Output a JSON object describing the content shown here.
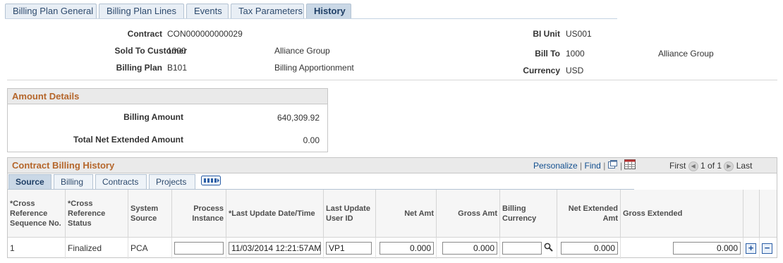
{
  "tabs": [
    {
      "label": "Billing Plan General"
    },
    {
      "label": "Billing Plan Lines"
    },
    {
      "label": "Events"
    },
    {
      "label": "Tax Parameters"
    },
    {
      "label": "History"
    }
  ],
  "header": {
    "contract_label": "Contract",
    "contract_value": "CON000000000029",
    "sold_to_label": "Sold To Customer",
    "sold_to_value": "1000",
    "sold_to_name": "Alliance Group",
    "billing_plan_label": "Billing Plan",
    "billing_plan_value": "B101",
    "billing_plan_desc": "Billing Apportionment",
    "bi_unit_label": "BI Unit",
    "bi_unit_value": "US001",
    "bill_to_label": "Bill To",
    "bill_to_value": "1000",
    "bill_to_name": "Alliance Group",
    "currency_label": "Currency",
    "currency_value": "USD"
  },
  "amount_details": {
    "title": "Amount Details",
    "billing_amount_label": "Billing Amount",
    "billing_amount_value": "640,309.92",
    "total_net_label": "Total Net Extended Amount",
    "total_net_value": "0.00"
  },
  "history": {
    "title": "Contract Billing History",
    "personalize": "Personalize",
    "find": "Find",
    "first": "First",
    "page_info": "1 of 1",
    "last": "Last",
    "subtabs": [
      {
        "label": "Source"
      },
      {
        "label": "Billing"
      },
      {
        "label": "Contracts"
      },
      {
        "label": "Projects"
      }
    ],
    "columns": [
      "*Cross Reference Sequence No.",
      "*Cross Reference Status",
      "System Source",
      "Process Instance",
      "*Last Update Date/Time",
      "Last Update User ID",
      "Net Amt",
      "Gross Amt",
      "Billing Currency",
      "Net Extended Amt",
      "Gross Extended"
    ],
    "row": {
      "seq": "1",
      "status": "Finalized",
      "system_source": "PCA",
      "process_instance": "",
      "last_update": "11/03/2014 12:21:57AM",
      "user_id": "VP1",
      "net_amt": "0.000",
      "gross_amt": "0.000",
      "billing_currency": "",
      "net_extended": "0.000",
      "gross_extended": "0.000"
    },
    "add_symbol": "+",
    "remove_symbol": "−"
  },
  "icons": [
    "new-window-icon",
    "spreadsheet-icon",
    "first-arrow-icon",
    "last-arrow-icon",
    "show-all-columns-icon",
    "lookup-icon",
    "add-row-icon",
    "delete-row-icon"
  ],
  "colors": {
    "section_title": "#b5662b",
    "link": "#124f8f",
    "tab_active": "#cad8e6"
  }
}
